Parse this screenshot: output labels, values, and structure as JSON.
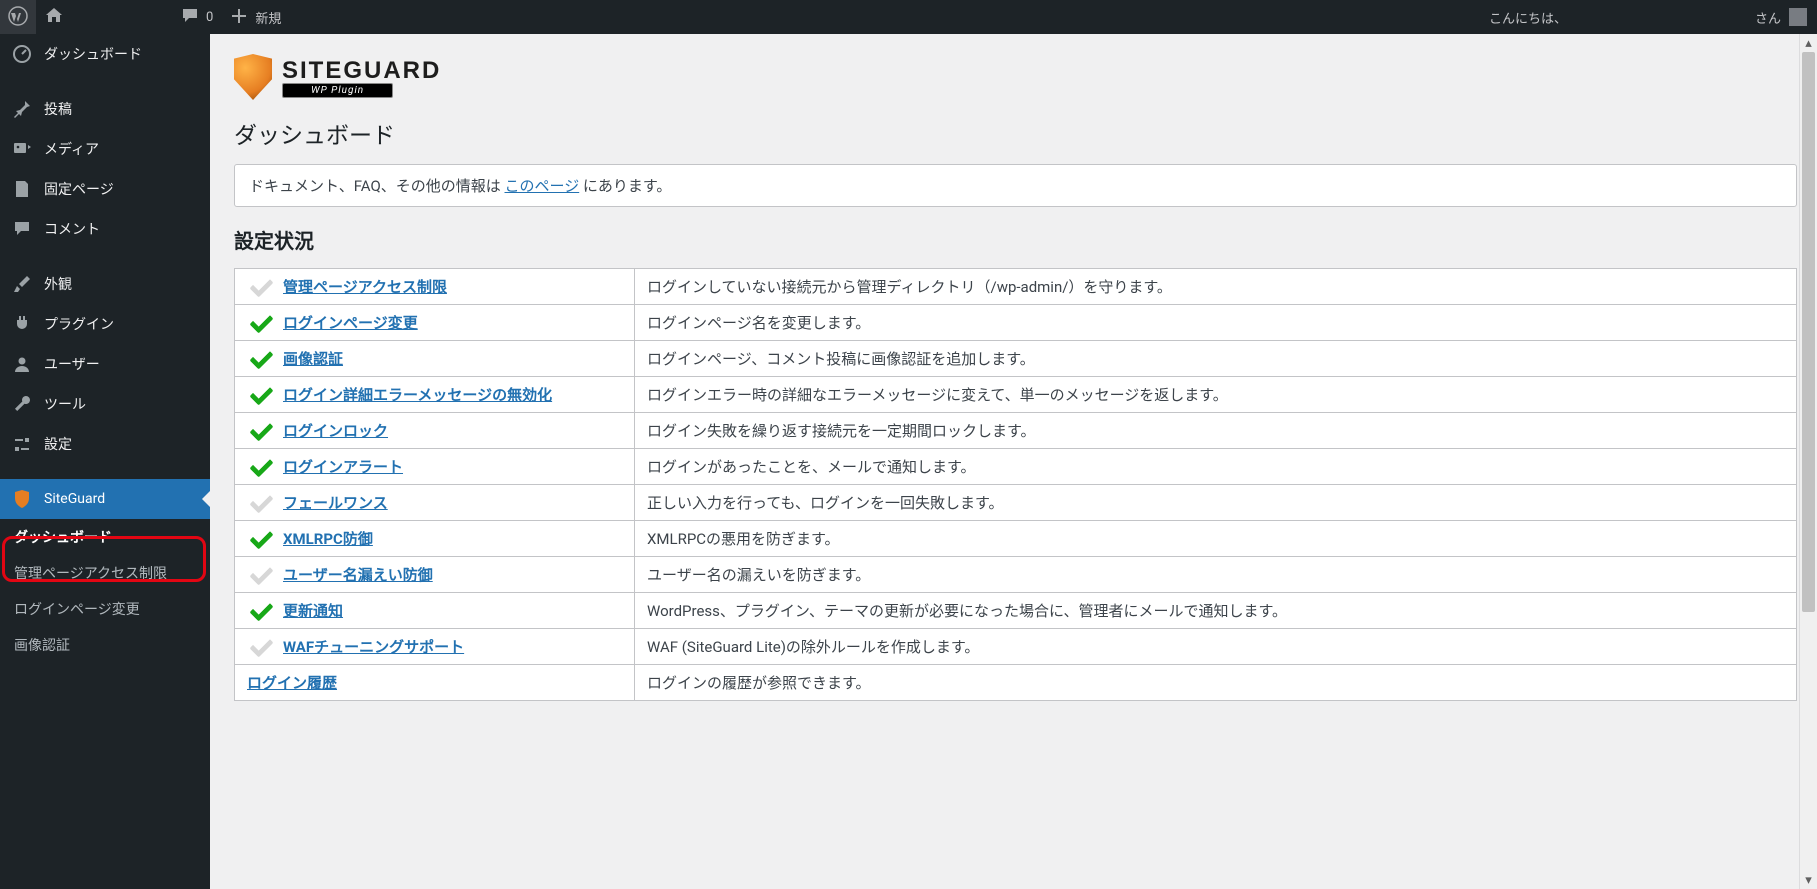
{
  "adminbar": {
    "comments_count": "0",
    "add_new": "新規",
    "greeting_prefix": "こんにちは、",
    "greeting_suffix": "さん"
  },
  "menu": {
    "dashboard": "ダッシュボード",
    "posts": "投稿",
    "media": "メディア",
    "pages": "固定ページ",
    "comments": "コメント",
    "appearance": "外観",
    "plugins": "プラグイン",
    "users": "ユーザー",
    "tools": "ツール",
    "settings": "設定",
    "siteguard": "SiteGuard"
  },
  "submenu": {
    "dashboard": "ダッシュボード",
    "admin_access": "管理ページアクセス制限",
    "login_page": "ログインページ変更",
    "captcha": "画像認証"
  },
  "logo": {
    "brand_a": "SITE",
    "brand_b": "GUARD",
    "sub": "WP Plugin"
  },
  "page": {
    "title": "ダッシュボード",
    "notice_before": "ドキュメント、FAQ、その他の情報は ",
    "notice_link": "このページ",
    "notice_after": " にあります。",
    "section": "設定状況"
  },
  "rows": [
    {
      "on": false,
      "name": "管理ページアクセス制限",
      "desc": "ログインしていない接続元から管理ディレクトリ（/wp-admin/）を守ります。"
    },
    {
      "on": true,
      "name": "ログインページ変更",
      "desc": "ログインページ名を変更します。"
    },
    {
      "on": true,
      "name": "画像認証",
      "desc": "ログインページ、コメント投稿に画像認証を追加します。"
    },
    {
      "on": true,
      "name": "ログイン詳細エラーメッセージの無効化",
      "desc": "ログインエラー時の詳細なエラーメッセージに変えて、単一のメッセージを返します。"
    },
    {
      "on": true,
      "name": "ログインロック",
      "desc": "ログイン失敗を繰り返す接続元を一定期間ロックします。"
    },
    {
      "on": true,
      "name": "ログインアラート",
      "desc": "ログインがあったことを、メールで通知します。"
    },
    {
      "on": false,
      "name": "フェールワンス",
      "desc": "正しい入力を行っても、ログインを一回失敗します。"
    },
    {
      "on": true,
      "name": "XMLRPC防御",
      "desc": "XMLRPCの悪用を防ぎます。"
    },
    {
      "on": false,
      "name": "ユーザー名漏えい防御",
      "desc": "ユーザー名の漏えいを防ぎます。"
    },
    {
      "on": true,
      "name": "更新通知",
      "desc": "WordPress、プラグイン、テーマの更新が必要になった場合に、管理者にメールで通知します。"
    },
    {
      "on": false,
      "name": "WAFチューニングサポート",
      "desc": "WAF (SiteGuard Lite)の除外ルールを作成します。"
    },
    {
      "on": null,
      "name": "ログイン履歴",
      "desc": "ログインの履歴が参照できます。"
    }
  ]
}
